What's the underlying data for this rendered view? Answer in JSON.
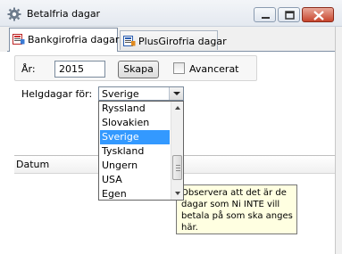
{
  "window": {
    "title": "Betalfria dagar",
    "icon": "gear-icon",
    "controls": [
      "minimize-icon",
      "maximize-icon",
      "close-icon"
    ]
  },
  "tabs": [
    {
      "label": "Bankgirofria dagar",
      "icon": "bankgiro-icon",
      "active": true
    },
    {
      "label": "PlusGirofria dagar",
      "icon": "plusgiro-icon",
      "active": false
    }
  ],
  "form": {
    "year_label": "År:",
    "year_value": "2015",
    "create_button": "Skapa",
    "advanced_label": "Avancerat",
    "advanced_checked": false,
    "holidays_label": "Helgdagar för:",
    "country_selected": "Sverige"
  },
  "dropdown": {
    "options": [
      "Ryssland",
      "Slovakien",
      "Sverige",
      "Tyskland",
      "Ungern",
      "USA",
      "Egen"
    ],
    "selected_index": 2
  },
  "grid": {
    "columns": [
      "Datum"
    ]
  },
  "tooltip": {
    "text": "Observera att det är de dagar som Ni INTE vill betala på som ska anges här."
  },
  "colors": {
    "selection": "#3399ff",
    "tooltip_bg": "#ffffe1",
    "close_button": "#c7452d"
  }
}
